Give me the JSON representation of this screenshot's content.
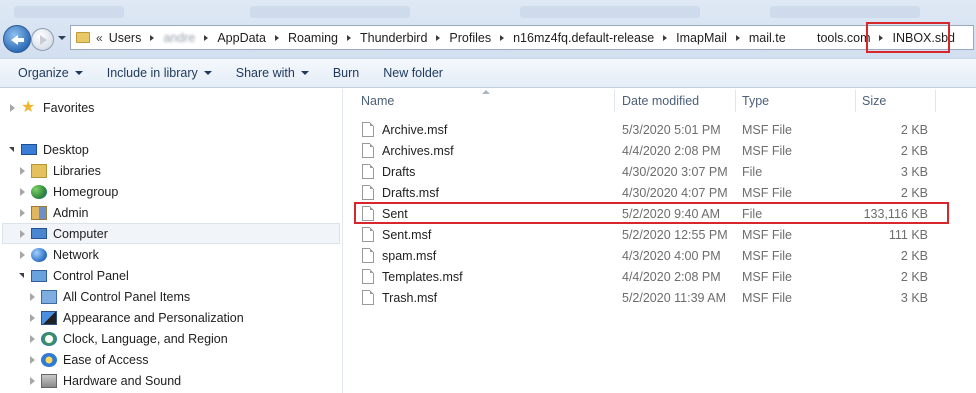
{
  "address_bar": {
    "overflow_chevron": "«",
    "crumbs": [
      "Users",
      "andre",
      "AppData",
      "Roaming",
      "Thunderbird",
      "Profiles",
      "n16mz4fq.default-release",
      "ImapMail",
      "mail.te",
      "tools.com",
      "INBOX.sbd"
    ]
  },
  "toolbar": {
    "organize": "Organize",
    "include_in_library": "Include in library",
    "share_with": "Share with",
    "burn": "Burn",
    "new_folder": "New folder"
  },
  "nav": {
    "favorites": "Favorites",
    "desktop": "Desktop",
    "libraries": "Libraries",
    "homegroup": "Homegroup",
    "admin": "Admin",
    "computer": "Computer",
    "network": "Network",
    "control_panel": "Control Panel",
    "all_cp_items": "All Control Panel Items",
    "appearance": "Appearance and Personalization",
    "clock": "Clock, Language, and Region",
    "ease": "Ease of Access",
    "hardware": "Hardware and Sound"
  },
  "columns": {
    "name": "Name",
    "date": "Date modified",
    "type": "Type",
    "size": "Size"
  },
  "files": [
    {
      "name": "Archive.msf",
      "date": "5/3/2020 5:01 PM",
      "type": "MSF File",
      "size": "2 KB"
    },
    {
      "name": "Archives.msf",
      "date": "4/4/2020 2:08 PM",
      "type": "MSF File",
      "size": "2 KB"
    },
    {
      "name": "Drafts",
      "date": "4/30/2020 3:07 PM",
      "type": "File",
      "size": "3 KB"
    },
    {
      "name": "Drafts.msf",
      "date": "4/30/2020 4:07 PM",
      "type": "MSF File",
      "size": "2 KB"
    },
    {
      "name": "Sent",
      "date": "5/2/2020 9:40 AM",
      "type": "File",
      "size": "133,116 KB"
    },
    {
      "name": "Sent.msf",
      "date": "5/2/2020 12:55 PM",
      "type": "MSF File",
      "size": "111 KB"
    },
    {
      "name": "spam.msf",
      "date": "4/3/2020 4:00 PM",
      "type": "MSF File",
      "size": "2 KB"
    },
    {
      "name": "Templates.msf",
      "date": "4/4/2020 2:08 PM",
      "type": "MSF File",
      "size": "2 KB"
    },
    {
      "name": "Trash.msf",
      "date": "5/2/2020 11:39 AM",
      "type": "MSF File",
      "size": "3 KB"
    }
  ],
  "highlight_color": "#d9262c"
}
